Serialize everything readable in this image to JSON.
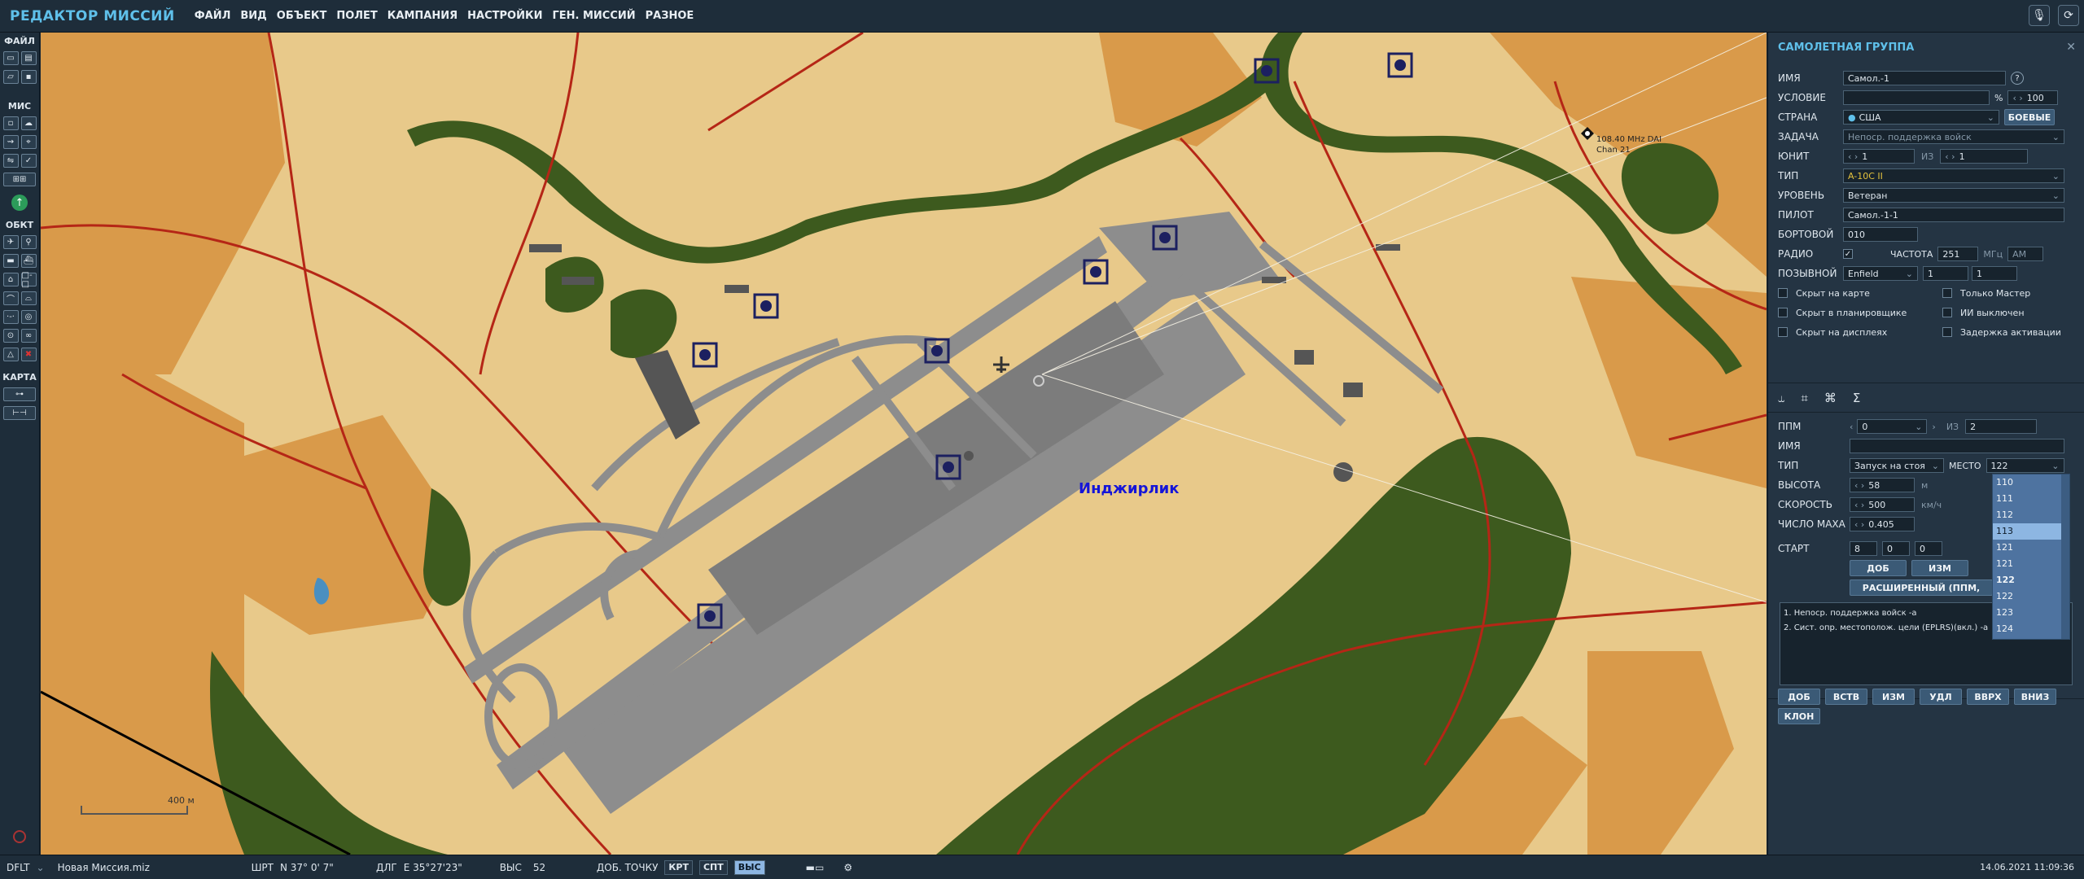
{
  "app": {
    "title": "РЕДАКТОР МИССИЙ"
  },
  "menu": [
    "ФАЙЛ",
    "ВИД",
    "ОБЪЕКТ",
    "ПОЛЕТ",
    "КАМПАНИЯ",
    "НАСТРОЙКИ",
    "ГЕН. МИССИЙ",
    "РАЗНОЕ"
  ],
  "toolbar_sections": {
    "file": "ФАЙЛ",
    "mission": "МИС",
    "objects": "ОБКТ",
    "map": "КАРТА"
  },
  "map": {
    "airfield_label": "Инджирлик",
    "nav_aid_line1": "108.40 MHz DAI",
    "nav_aid_line2": "Chan 21",
    "scale_label": "400 м"
  },
  "panel": {
    "title": "САМОЛЕТНАЯ ГРУППА",
    "name_label": "ИМЯ",
    "name_value": "Самол.-1",
    "help": "?",
    "condition_label": "УСЛОВИЕ",
    "condition_value": "",
    "percent_sign": "%",
    "probability": "100",
    "country_label": "СТРАНА",
    "country_value": "США",
    "combat_button": "БОЕВЫЕ",
    "task_label": "ЗАДАЧА",
    "task_value": "Непоср. поддержка войск",
    "unit_label": "ЮНИТ",
    "unit_value": "1",
    "of_label": "ИЗ",
    "unit_total": "1",
    "type_label": "ТИП",
    "type_value": "A-10C II",
    "skill_label": "УРОВЕНЬ",
    "skill_value": "Ветеран",
    "pilot_label": "ПИЛОТ",
    "pilot_value": "Самол.-1-1",
    "tail_label": "БОРТОВОЙ",
    "tail_value": "010",
    "radio_label": "РАДИО",
    "freq_label": "ЧАСТОТА",
    "freq_value": "251",
    "freq_unit": "МГц",
    "modulation": "AM",
    "callsign_label": "ПОЗЫВНОЙ",
    "callsign_value": "Enfield",
    "callsign_n1": "1",
    "callsign_n2": "1",
    "checks": [
      "Скрыт на карте",
      "Только Мастер",
      "Скрыт в планировщике",
      "ИИ выключен",
      "Скрыт на дисплеях",
      "Задержка активации"
    ],
    "wp_label": "ППМ",
    "wp_value": "0",
    "wp_of": "ИЗ",
    "wp_total": "2",
    "wp_name_label": "ИМЯ",
    "wp_name_value": "",
    "wp_type_label": "ТИП",
    "wp_type_value": "Запуск на стоя",
    "place_label": "МЕСТО",
    "place_value": "122",
    "alt_label": "ВЫСОТА",
    "alt_value": "58",
    "alt_unit": "м",
    "speed_label": "СКОРОСТЬ",
    "speed_value": "500",
    "speed_unit": "км/ч",
    "mach_label": "ЧИСЛО МАХА",
    "mach_value": "0.405",
    "start_label": "СТАРТ",
    "start_h": "8",
    "start_m": "0",
    "start_s": "0",
    "add_button": "ДОБ",
    "edit_button": "ИЗМ",
    "advanced_button": "РАСШИРЕННЫЙ (ППМ,",
    "actions": [
      "1. Непоср. поддержка войск -а",
      "2. Сист. опр. местополож. цели (EPLRS)(вкл.) -а"
    ],
    "action_buttons": [
      "ДОБ",
      "ВСТВ",
      "ИЗМ",
      "УДЛ",
      "ВВРХ",
      "ВНИЗ",
      "КЛОН"
    ],
    "dropdown_items": [
      "110",
      "111",
      "112",
      "113",
      "121",
      "121",
      "122",
      "122",
      "123",
      "124"
    ],
    "tab_icons": [
      "route-icon",
      "target-icon",
      "payload-icon",
      "summary-icon"
    ],
    "tab_glyphs": [
      "⥿",
      "⌗",
      "⌘",
      "Σ"
    ]
  },
  "status": {
    "profile": "DFLT",
    "file": "Новая Миссия.miz",
    "lat_label": "ШРТ",
    "lat_value": "N 37° 0' 7\"",
    "lon_label": "ДЛГ",
    "lon_value": "E 35°27'23\"",
    "alt_label": "ВЫС",
    "alt_value": "52",
    "add_point": "ДОБ. ТОЧКУ",
    "modes": [
      "КРТ",
      "СПТ",
      "ВЫС"
    ],
    "datetime": "14.06.2021 11:09:36"
  },
  "colors": {
    "accent": "#5fc0ea",
    "map_sand": "#e8c98a",
    "map_orange": "#d99a4a",
    "map_green": "#3d5a1e",
    "runway": "#8d8d8d",
    "road": "#b52616"
  }
}
